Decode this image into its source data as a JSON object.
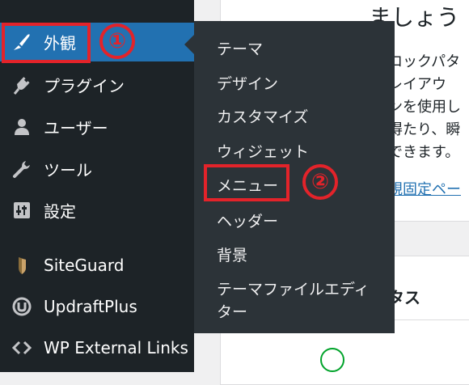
{
  "colors": {
    "sidebar_bg": "#1d2327",
    "flyout_bg": "#2c3338",
    "active_bg": "#2271b1",
    "annotation_red": "#e3232a",
    "status_green": "#00a32a"
  },
  "sidebar": {
    "items": [
      {
        "label": "外観",
        "icon": "paintbrush-icon"
      },
      {
        "label": "プラグイン",
        "icon": "plug-icon"
      },
      {
        "label": "ユーザー",
        "icon": "user-icon"
      },
      {
        "label": "ツール",
        "icon": "wrench-icon"
      },
      {
        "label": "設定",
        "icon": "sliders-icon"
      },
      {
        "label": "SiteGuard",
        "icon": "siteguard-icon"
      },
      {
        "label": "UpdraftPlus",
        "icon": "updraftplus-icon"
      },
      {
        "label": "WP External Links",
        "icon": "external-links-icon"
      }
    ]
  },
  "flyout": {
    "items": [
      {
        "label": "テーマ"
      },
      {
        "label": "デザイン"
      },
      {
        "label": "カスタマイズ"
      },
      {
        "label": "ウィジェット"
      },
      {
        "label": "メニュー"
      },
      {
        "label": "ヘッダー"
      },
      {
        "label": "背景"
      },
      {
        "label": "テーマファイルエディ"
      },
      {
        "label": "ター"
      }
    ]
  },
  "annotations": {
    "step1": "①",
    "step2": "②"
  },
  "content": {
    "heading_partial": "ましょう",
    "para": [
      "ロックパタ",
      "レイアウ",
      "ンを使用し",
      "得たり、瞬",
      "できます。"
    ],
    "link_partial": "規固定ペー",
    "card_title_partial": "タス"
  }
}
